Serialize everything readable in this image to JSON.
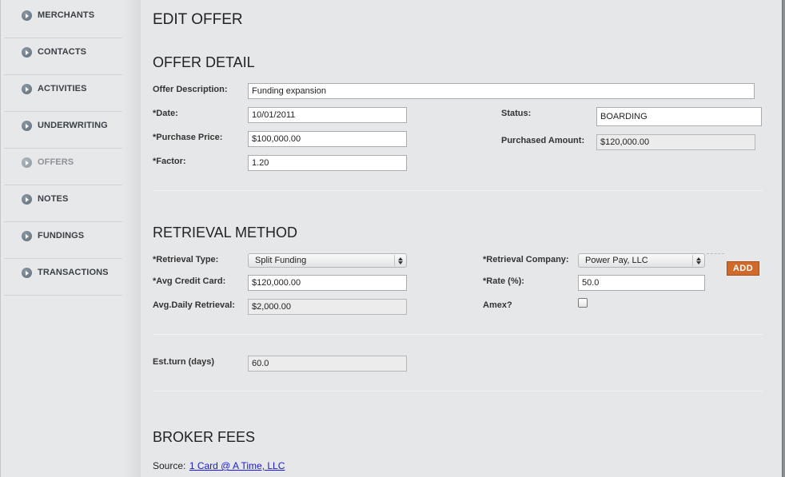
{
  "sidebar": {
    "items": [
      {
        "label": "MERCHANTS"
      },
      {
        "label": "CONTACTS"
      },
      {
        "label": "ACTIVITIES"
      },
      {
        "label": "UNDERWRITING"
      },
      {
        "label": "OFFERS",
        "active": true
      },
      {
        "label": "NOTES"
      },
      {
        "label": "FUNDINGS"
      },
      {
        "label": "TRANSACTIONS"
      }
    ]
  },
  "page": {
    "title": "EDIT OFFER"
  },
  "offer_detail": {
    "heading": "OFFER DETAIL",
    "description_label": "Offer Description:",
    "description_value": "Funding expansion",
    "date_label": "*Date:",
    "date_value": "10/01/2011",
    "purchase_price_label": "*Purchase Price:",
    "purchase_price_value": "$100,000.00",
    "factor_label": "*Factor:",
    "factor_value": "1.20",
    "status_label": "Status:",
    "status_value": "BOARDING",
    "purchased_amount_label": "Purchased Amount:",
    "purchased_amount_value": "$120,000.00"
  },
  "retrieval": {
    "heading": "RETRIEVAL METHOD",
    "type_label": "*Retrieval Type:",
    "type_value": "Split Funding",
    "avg_cc_label": "*Avg Credit Card:",
    "avg_cc_value": "$120,000.00",
    "avg_daily_label": "Avg.Daily Retrieval:",
    "avg_daily_value": "$2,000.00",
    "company_label": "*Retrieval Company:",
    "company_value": "Power Pay, LLC",
    "add_label": "ADD",
    "rate_label": "*Rate (%):",
    "rate_value": "50.0",
    "amex_label": "Amex?",
    "est_turn_label": "Est.turn (days)",
    "est_turn_value": "60.0"
  },
  "broker": {
    "heading": "BROKER FEES",
    "source_label": "Source:",
    "source_link": "1 Card @ A Time, LLC"
  },
  "colors": {
    "accent_button": "#d0692a",
    "link": "#1a1ad6"
  }
}
